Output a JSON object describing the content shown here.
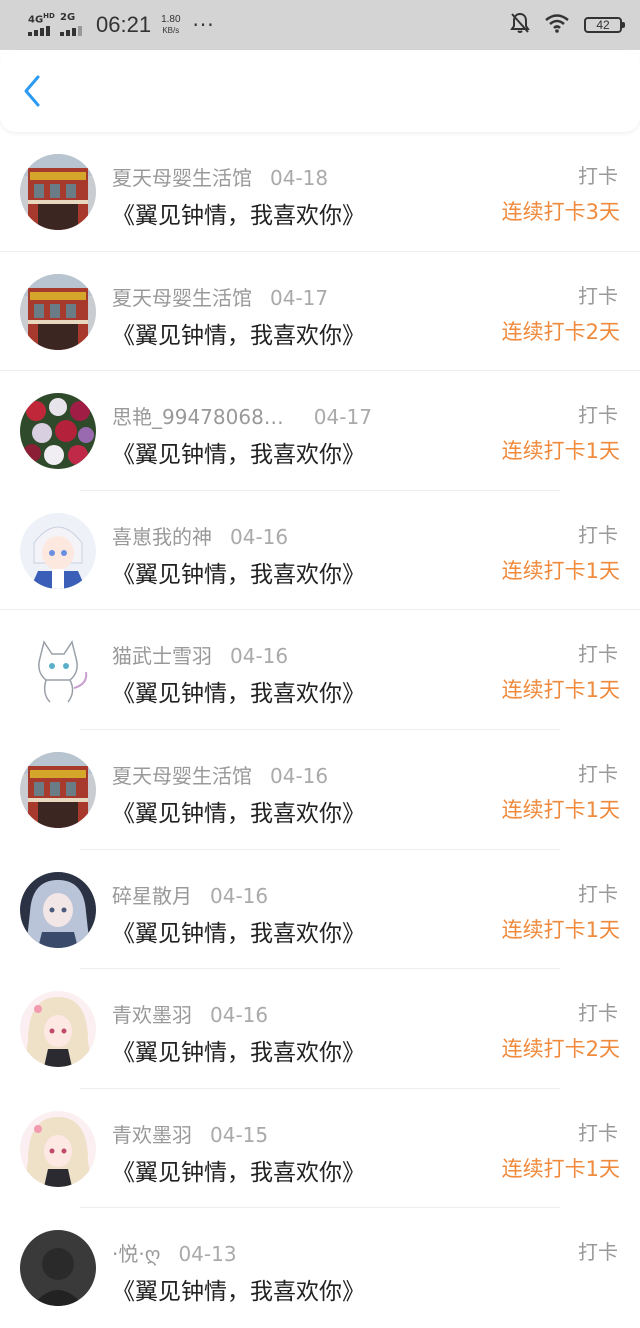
{
  "status_bar": {
    "network1": "4G",
    "network1_sup": "HD",
    "network2": "2G",
    "time": "06:21",
    "speed_value": "1.80",
    "speed_unit": "KB/s",
    "dots": "···",
    "battery": "42",
    "icons": [
      "mute-bell-icon",
      "wifi-icon",
      "battery-icon"
    ]
  },
  "nav": {
    "back_icon": "chevron-left-icon",
    "accent_color": "#2b9af3"
  },
  "colors": {
    "streak": "#f08a3c",
    "muted": "#999999",
    "title": "#222222"
  },
  "items": [
    {
      "user": "夏天母婴生活馆",
      "date": "04-18",
      "title": "《翼见钟情，我喜欢你》",
      "action": "打卡",
      "streak": "连续打卡3天",
      "avatar": "storefront"
    },
    {
      "user": "夏天母婴生活馆",
      "date": "04-17",
      "title": "《翼见钟情，我喜欢你》",
      "action": "打卡",
      "streak": "连续打卡2天",
      "avatar": "storefront"
    },
    {
      "user": "思艳_99478068…",
      "date": "04-17",
      "title": "《翼见钟情，我喜欢你》",
      "action": "打卡",
      "streak": "连续打卡1天",
      "avatar": "flowers"
    },
    {
      "user": "喜崽我的神",
      "date": "04-16",
      "title": "《翼见钟情，我喜欢你》",
      "action": "打卡",
      "streak": "连续打卡1天",
      "avatar": "anime-white-hair"
    },
    {
      "user": "猫武士雪羽",
      "date": "04-16",
      "title": "《翼见钟情，我喜欢你》",
      "action": "打卡",
      "streak": "连续打卡1天",
      "avatar": "cat-sketch"
    },
    {
      "user": "夏天母婴生活馆",
      "date": "04-16",
      "title": "《翼见钟情，我喜欢你》",
      "action": "打卡",
      "streak": "连续打卡1天",
      "avatar": "storefront"
    },
    {
      "user": "碎星散月",
      "date": "04-16",
      "title": "《翼见钟情，我喜欢你》",
      "action": "打卡",
      "streak": "连续打卡1天",
      "avatar": "anime-dark-blue"
    },
    {
      "user": "青欢墨羽",
      "date": "04-16",
      "title": "《翼见钟情，我喜欢你》",
      "action": "打卡",
      "streak": "连续打卡2天",
      "avatar": "anime-pink"
    },
    {
      "user": "青欢墨羽",
      "date": "04-15",
      "title": "《翼见钟情，我喜欢你》",
      "action": "打卡",
      "streak": "连续打卡1天",
      "avatar": "anime-pink"
    },
    {
      "user": "·悦·ღ",
      "date": "04-13",
      "title": "《翼见钟情，我喜欢你》",
      "action": "打卡",
      "streak": "",
      "avatar": "dark"
    }
  ]
}
